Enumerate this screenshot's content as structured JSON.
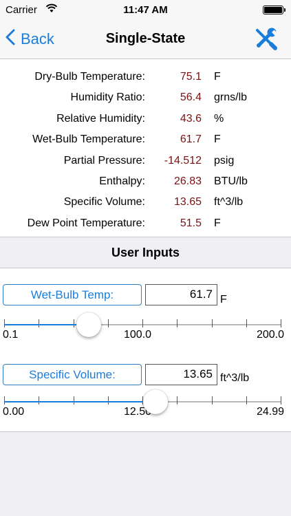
{
  "status": {
    "carrier": "Carrier",
    "time": "11:47 AM"
  },
  "nav": {
    "back_label": "Back",
    "title": "Single-State"
  },
  "results": [
    {
      "label": "Dry-Bulb Temperature:",
      "value": "75.1",
      "unit": "F"
    },
    {
      "label": "Humidity Ratio:",
      "value": "56.4",
      "unit": "grns/lb"
    },
    {
      "label": "Relative Humidity:",
      "value": "43.6",
      "unit": "%"
    },
    {
      "label": "Wet-Bulb Temperature:",
      "value": "61.7",
      "unit": "F"
    },
    {
      "label": "Partial Pressure:",
      "value": "-14.512",
      "unit": "psig"
    },
    {
      "label": "Enthalpy:",
      "value": "26.83",
      "unit": "BTU/lb"
    },
    {
      "label": "Specific Volume:",
      "value": "13.65",
      "unit": "ft^3/lb"
    },
    {
      "label": "Dew Point Temperature:",
      "value": "51.5",
      "unit": "F"
    }
  ],
  "inputs_header": "User Inputs",
  "inputs": [
    {
      "button_label": "Wet-Bulb Temp:",
      "value": "61.7",
      "unit": "F",
      "slider": {
        "min_label": "0.1",
        "mid_label": "100.0",
        "max_label": "200.0",
        "fraction": 0.305
      }
    },
    {
      "button_label": "Specific Volume:",
      "value": "13.65",
      "unit": "ft^3/lb",
      "slider": {
        "min_label": "0.00",
        "mid_label": "12.50",
        "max_label": "24.99",
        "fraction": 0.546
      }
    }
  ],
  "colors": {
    "accent": "#1a7ddb",
    "value_text": "#7d1010"
  }
}
